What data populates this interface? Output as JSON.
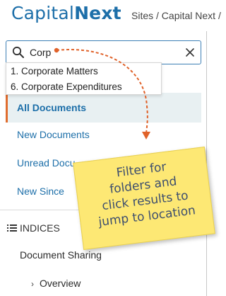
{
  "header": {
    "logo_part1": "Capital",
    "logo_part2": "Next",
    "breadcrumb": "Sites / Capital Next /"
  },
  "search": {
    "value": "Corp",
    "results": [
      "1. Corporate Matters",
      "6. Corporate Expenditures"
    ]
  },
  "nav": {
    "items": [
      "All Documents",
      "New Documents",
      "Unread Docu",
      "New Since"
    ]
  },
  "indices": {
    "heading": "INDICES",
    "items": [
      "Document Sharing",
      "Overview"
    ]
  },
  "callout": {
    "text": "Filter for\nfolders and\nclick results to\njump to location"
  },
  "colors": {
    "brand": "#1d6fa9",
    "active_indicator": "#e06d2f",
    "note": "#fde874",
    "arrow": "#e0622a"
  }
}
